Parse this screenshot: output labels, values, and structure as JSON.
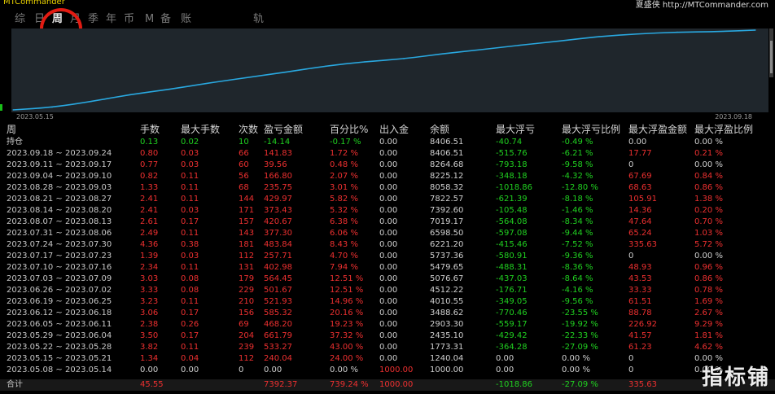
{
  "app_title": "MTCommander",
  "brand": "夏盛侠 http://MTCommander.com",
  "tabs": [
    {
      "label": "综",
      "active": false
    },
    {
      "label": "日",
      "active": false
    },
    {
      "label": "周",
      "active": true
    },
    {
      "label": "月",
      "active": false
    },
    {
      "label": "季",
      "active": false
    },
    {
      "label": "年",
      "active": false
    },
    {
      "label": "币",
      "active": false
    },
    {
      "label": "M",
      "active": false
    },
    {
      "label": "备",
      "active": false
    },
    {
      "label": "账户",
      "active": false
    },
    {
      "label": "轨迹",
      "active": false
    }
  ],
  "colors": {
    "curve": "#29a8e0",
    "chart_bg": "#1f262c",
    "positive": "#ee3030",
    "negative": "#20d020",
    "highlight": "#e21b12"
  },
  "chart_data": {
    "type": "line",
    "x_start_label": "2023.05.15",
    "x_end_label": "2023.09.18",
    "series": [
      {
        "values": [
          1000.0,
          1240.04,
          1773.31,
          2435.1,
          2903.3,
          3488.62,
          4010.55,
          4512.22,
          5076.67,
          5479.65,
          5737.36,
          6221.2,
          6598.5,
          7019.17,
          7392.6,
          7822.57,
          8058.32,
          8225.12,
          8264.68,
          8406.51
        ]
      }
    ]
  },
  "table": {
    "headers": [
      "周",
      "手数",
      "最大手数",
      "次数",
      "盈亏金额",
      "百分比%",
      "出入金",
      "余额",
      "最大浮亏",
      "最大浮亏比例",
      "最大浮盈金额",
      "最大浮盈比例"
    ],
    "rows": [
      {
        "cells": [
          "持仓",
          "0.13",
          "0.02",
          "10",
          "-14.14",
          "-0.17 %",
          "0.00",
          "8406.51",
          "-40.74",
          "-0.49 %",
          "0.00",
          "0.00 %"
        ],
        "cls": [
          "label",
          "neg",
          "neg",
          "neg",
          "neg",
          "neg",
          "neu",
          "neu",
          "neg",
          "neg",
          "neu",
          "neu"
        ]
      },
      {
        "cells": [
          "2023.09.18 ~ 2023.09.24",
          "0.80",
          "0.03",
          "66",
          "141.83",
          "1.72 %",
          "0.00",
          "8406.51",
          "-515.76",
          "-6.21 %",
          "17.77",
          "0.21 %"
        ],
        "cls": [
          "label",
          "pos",
          "pos",
          "pos",
          "pos",
          "pos",
          "neu",
          "neu",
          "neg",
          "neg",
          "pos",
          "pos"
        ]
      },
      {
        "cells": [
          "2023.09.11 ~ 2023.09.17",
          "0.77",
          "0.03",
          "60",
          "39.56",
          "0.48 %",
          "0.00",
          "8264.68",
          "-793.18",
          "-9.58 %",
          "0",
          "0.00 %"
        ],
        "cls": [
          "label",
          "pos",
          "pos",
          "pos",
          "pos",
          "pos",
          "neu",
          "neu",
          "neg",
          "neg",
          "neu",
          "neu"
        ]
      },
      {
        "cells": [
          "2023.09.04 ~ 2023.09.10",
          "0.82",
          "0.11",
          "56",
          "166.80",
          "2.07 %",
          "0.00",
          "8225.12",
          "-348.18",
          "-4.32 %",
          "67.69",
          "0.84 %"
        ],
        "cls": [
          "label",
          "pos",
          "pos",
          "pos",
          "pos",
          "pos",
          "neu",
          "neu",
          "neg",
          "neg",
          "pos",
          "pos"
        ]
      },
      {
        "cells": [
          "2023.08.28 ~ 2023.09.03",
          "1.33",
          "0.11",
          "68",
          "235.75",
          "3.01 %",
          "0.00",
          "8058.32",
          "-1018.86",
          "-12.80 %",
          "68.63",
          "0.86 %"
        ],
        "cls": [
          "label",
          "pos",
          "pos",
          "pos",
          "pos",
          "pos",
          "neu",
          "neu",
          "neg",
          "neg",
          "pos",
          "pos"
        ]
      },
      {
        "cells": [
          "2023.08.21 ~ 2023.08.27",
          "2.41",
          "0.11",
          "144",
          "429.97",
          "5.82 %",
          "0.00",
          "7822.57",
          "-621.39",
          "-8.18 %",
          "105.91",
          "1.38 %"
        ],
        "cls": [
          "label",
          "pos",
          "pos",
          "pos",
          "pos",
          "pos",
          "neu",
          "neu",
          "neg",
          "neg",
          "pos",
          "pos"
        ]
      },
      {
        "cells": [
          "2023.08.14 ~ 2023.08.20",
          "2.41",
          "0.03",
          "171",
          "373.43",
          "5.32 %",
          "0.00",
          "7392.60",
          "-105.48",
          "-1.46 %",
          "14.36",
          "0.20 %"
        ],
        "cls": [
          "label",
          "pos",
          "pos",
          "pos",
          "pos",
          "pos",
          "neu",
          "neu",
          "neg",
          "neg",
          "pos",
          "pos"
        ]
      },
      {
        "cells": [
          "2023.08.07 ~ 2023.08.13",
          "2.61",
          "0.17",
          "157",
          "420.67",
          "6.38 %",
          "0.00",
          "7019.17",
          "-564.08",
          "-8.34 %",
          "47.64",
          "0.70 %"
        ],
        "cls": [
          "label",
          "pos",
          "pos",
          "pos",
          "pos",
          "pos",
          "neu",
          "neu",
          "neg",
          "neg",
          "pos",
          "pos"
        ]
      },
      {
        "cells": [
          "2023.07.31 ~ 2023.08.06",
          "2.49",
          "0.11",
          "143",
          "377.30",
          "6.06 %",
          "0.00",
          "6598.50",
          "-597.08",
          "-9.44 %",
          "65.24",
          "1.03 %"
        ],
        "cls": [
          "label",
          "pos",
          "pos",
          "pos",
          "pos",
          "pos",
          "neu",
          "neu",
          "neg",
          "neg",
          "pos",
          "pos"
        ]
      },
      {
        "cells": [
          "2023.07.24 ~ 2023.07.30",
          "4.36",
          "0.38",
          "181",
          "483.84",
          "8.43 %",
          "0.00",
          "6221.20",
          "-415.46",
          "-7.52 %",
          "335.63",
          "5.72 %"
        ],
        "cls": [
          "label",
          "pos",
          "pos",
          "pos",
          "pos",
          "pos",
          "neu",
          "neu",
          "neg",
          "neg",
          "pos",
          "pos"
        ]
      },
      {
        "cells": [
          "2023.07.17 ~ 2023.07.23",
          "1.39",
          "0.03",
          "112",
          "257.71",
          "4.70 %",
          "0.00",
          "5737.36",
          "-580.91",
          "-9.36 %",
          "0",
          "0.00 %"
        ],
        "cls": [
          "label",
          "pos",
          "pos",
          "pos",
          "pos",
          "pos",
          "neu",
          "neu",
          "neg",
          "neg",
          "neu",
          "neu"
        ]
      },
      {
        "cells": [
          "2023.07.10 ~ 2023.07.16",
          "2.34",
          "0.11",
          "131",
          "402.98",
          "7.94 %",
          "0.00",
          "5479.65",
          "-488.31",
          "-8.36 %",
          "48.93",
          "0.96 %"
        ],
        "cls": [
          "label",
          "pos",
          "pos",
          "pos",
          "pos",
          "pos",
          "neu",
          "neu",
          "neg",
          "neg",
          "pos",
          "pos"
        ]
      },
      {
        "cells": [
          "2023.07.03 ~ 2023.07.09",
          "3.03",
          "0.08",
          "179",
          "564.45",
          "12.51 %",
          "0.00",
          "5076.67",
          "-437.03",
          "-8.64 %",
          "43.53",
          "0.86 %"
        ],
        "cls": [
          "label",
          "pos",
          "pos",
          "pos",
          "pos",
          "pos",
          "neu",
          "neu",
          "neg",
          "neg",
          "pos",
          "pos"
        ]
      },
      {
        "cells": [
          "2023.06.26 ~ 2023.07.02",
          "3.33",
          "0.08",
          "229",
          "501.67",
          "12.51 %",
          "0.00",
          "4512.22",
          "-176.71",
          "-4.16 %",
          "33.33",
          "0.78 %"
        ],
        "cls": [
          "label",
          "pos",
          "pos",
          "pos",
          "pos",
          "pos",
          "neu",
          "neu",
          "neg",
          "neg",
          "pos",
          "pos"
        ]
      },
      {
        "cells": [
          "2023.06.19 ~ 2023.06.25",
          "3.23",
          "0.11",
          "210",
          "521.93",
          "14.96 %",
          "0.00",
          "4010.55",
          "-349.05",
          "-9.56 %",
          "61.51",
          "1.69 %"
        ],
        "cls": [
          "label",
          "pos",
          "pos",
          "pos",
          "pos",
          "pos",
          "neu",
          "neu",
          "neg",
          "neg",
          "pos",
          "pos"
        ]
      },
      {
        "cells": [
          "2023.06.12 ~ 2023.06.18",
          "3.06",
          "0.17",
          "156",
          "585.32",
          "20.16 %",
          "0.00",
          "3488.62",
          "-770.46",
          "-23.55 %",
          "88.78",
          "2.67 %"
        ],
        "cls": [
          "label",
          "pos",
          "pos",
          "pos",
          "pos",
          "pos",
          "neu",
          "neu",
          "neg",
          "neg",
          "pos",
          "pos"
        ]
      },
      {
        "cells": [
          "2023.06.05 ~ 2023.06.11",
          "2.38",
          "0.26",
          "69",
          "468.20",
          "19.23 %",
          "0.00",
          "2903.30",
          "-559.17",
          "-19.92 %",
          "226.92",
          "9.29 %"
        ],
        "cls": [
          "label",
          "pos",
          "pos",
          "pos",
          "pos",
          "pos",
          "neu",
          "neu",
          "neg",
          "neg",
          "pos",
          "pos"
        ]
      },
      {
        "cells": [
          "2023.05.29 ~ 2023.06.04",
          "3.50",
          "0.17",
          "204",
          "661.79",
          "37.32 %",
          "0.00",
          "2435.10",
          "-429.42",
          "-22.33 %",
          "41.57",
          "1.81 %"
        ],
        "cls": [
          "label",
          "pos",
          "pos",
          "pos",
          "pos",
          "pos",
          "neu",
          "neu",
          "neg",
          "neg",
          "pos",
          "pos"
        ]
      },
      {
        "cells": [
          "2023.05.22 ~ 2023.05.28",
          "3.82",
          "0.11",
          "239",
          "533.27",
          "43.00 %",
          "0.00",
          "1773.31",
          "-364.28",
          "-27.09 %",
          "61.23",
          "4.62 %"
        ],
        "cls": [
          "label",
          "pos",
          "pos",
          "pos",
          "pos",
          "pos",
          "neu",
          "neu",
          "neg",
          "neg",
          "pos",
          "pos"
        ]
      },
      {
        "cells": [
          "2023.05.15 ~ 2023.05.21",
          "1.34",
          "0.04",
          "112",
          "240.04",
          "24.00 %",
          "0.00",
          "1240.04",
          "0.00",
          "0.00 %",
          "0",
          "0.00 %"
        ],
        "cls": [
          "label",
          "pos",
          "pos",
          "pos",
          "pos",
          "pos",
          "neu",
          "neu",
          "neu",
          "neu",
          "neu",
          "neu"
        ]
      },
      {
        "cells": [
          "2023.05.08 ~ 2023.05.14",
          "0.00",
          "0.00",
          "0",
          "0.00",
          "0.00 %",
          "1000.00",
          "1000.00",
          "0.00",
          "0.00 %",
          "0",
          "0.00 %"
        ],
        "cls": [
          "label",
          "neu",
          "neu",
          "neu",
          "neu",
          "neu",
          "pos",
          "neu",
          "neu",
          "neu",
          "neu",
          "neu"
        ]
      }
    ],
    "footer": {
      "cells": [
        "合计",
        "45.55",
        "",
        "",
        "7392.37",
        "739.24 %",
        "1000.00",
        "",
        "-1018.86",
        "-27.09 %",
        "335.63",
        ""
      ],
      "cls": [
        "label",
        "pos",
        "neu",
        "neu",
        "pos",
        "pos",
        "pos",
        "neu",
        "neg",
        "neg",
        "pos",
        "pos"
      ]
    }
  },
  "watermark": "指标铺"
}
